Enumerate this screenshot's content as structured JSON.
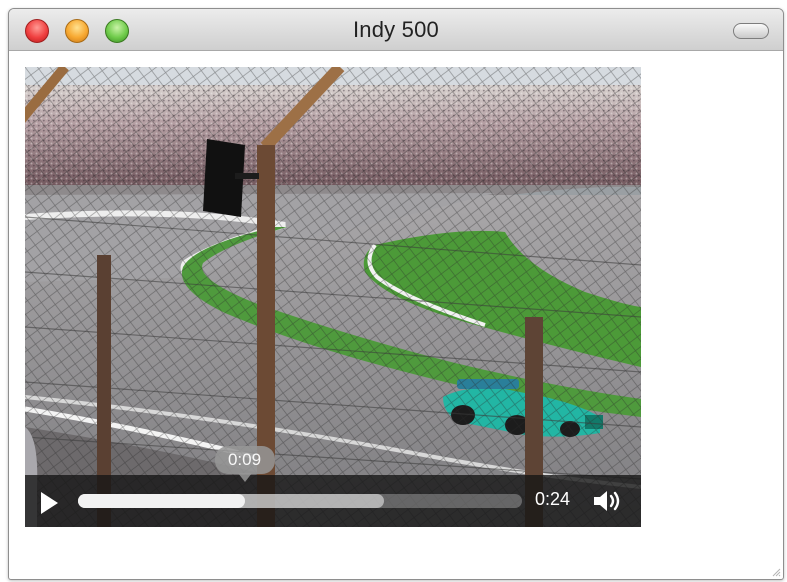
{
  "window": {
    "title": "Indy 500",
    "buttons": {
      "close": "close-button",
      "minimize": "minimize-button",
      "zoom": "zoom-button",
      "toolbar": "toolbar-toggle"
    }
  },
  "video": {
    "subject": "racing scene with grandstands, track and catch fence",
    "current_time": "0:09",
    "duration": "0:24",
    "progress_fraction": 0.375,
    "buffered_fraction": 0.69,
    "icons": {
      "play": "play-icon",
      "volume": "speaker-icon"
    }
  },
  "colors": {
    "track": "#b6b3b6",
    "grass": "#4f9a3d",
    "controls": "#1a1a1a",
    "car": "#22b6a4"
  }
}
